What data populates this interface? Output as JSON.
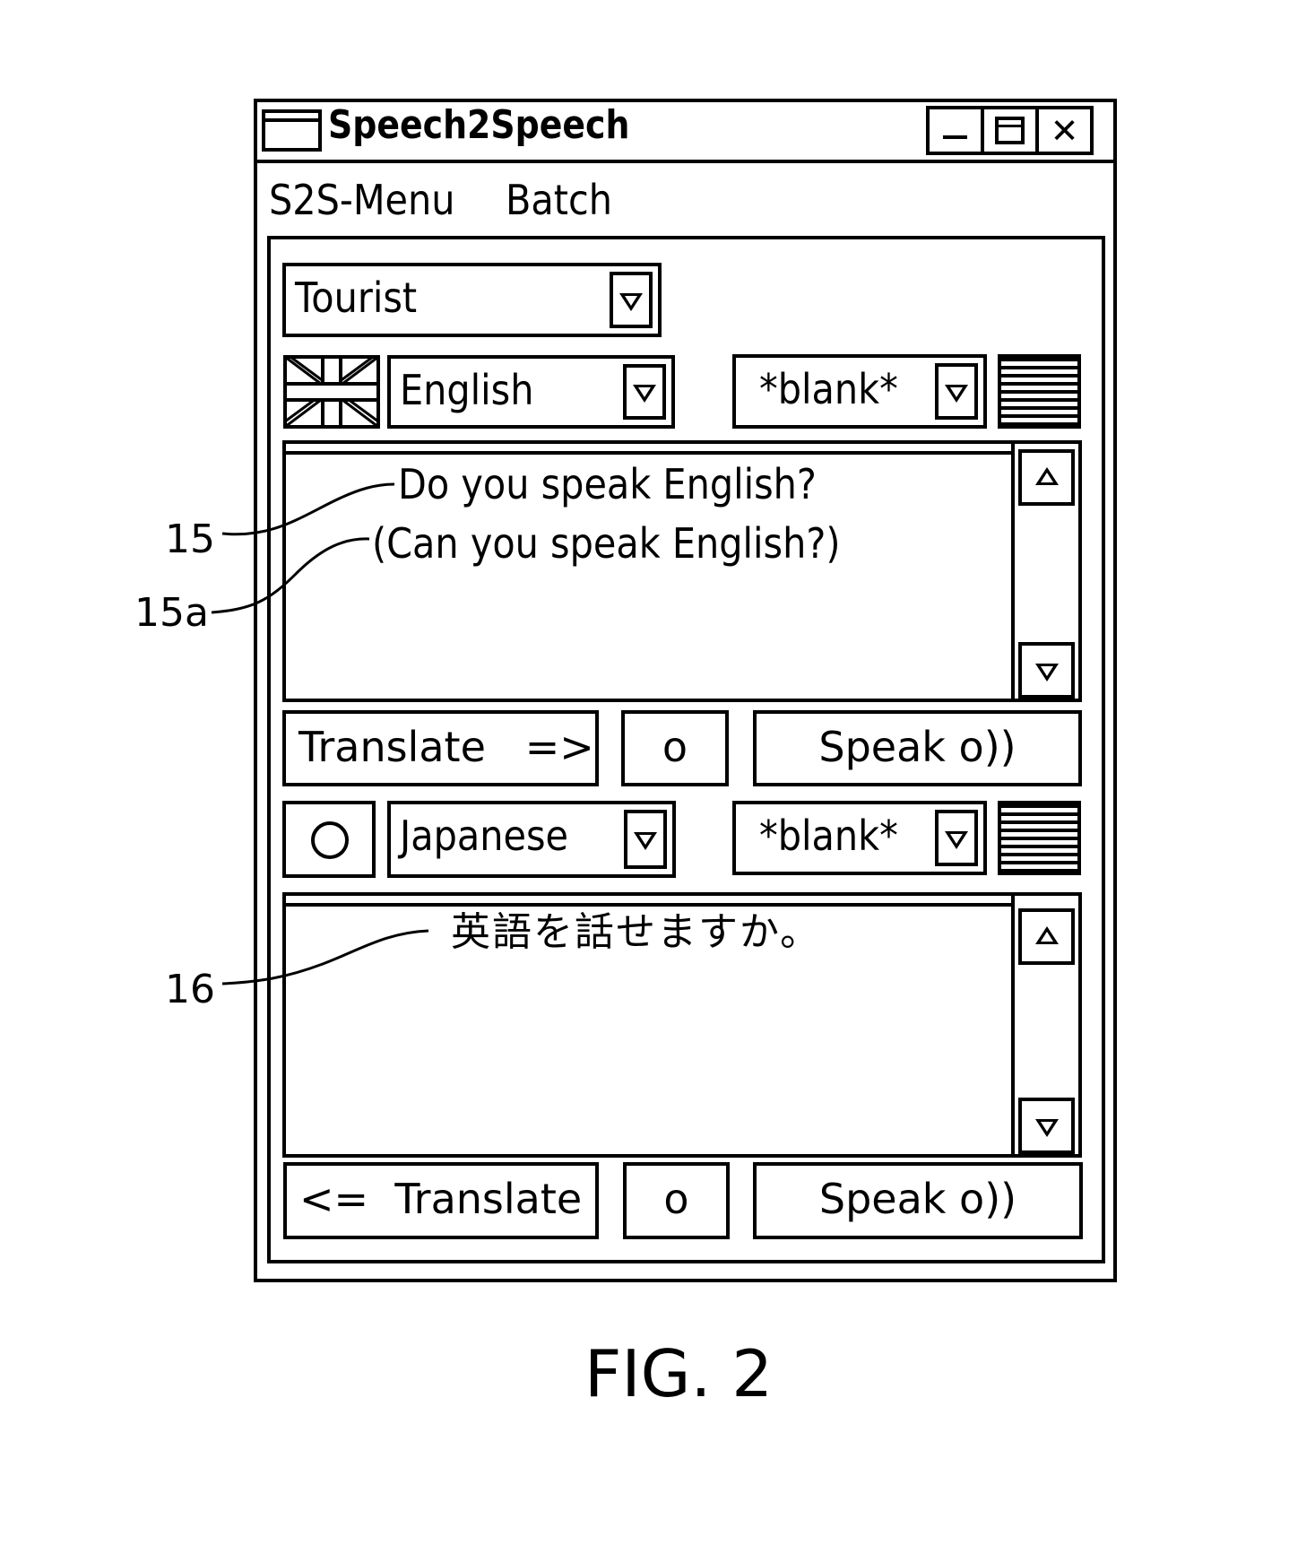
{
  "window": {
    "title": "Speech2Speech",
    "controls": {
      "minimize": "minimize",
      "maximize": "maximize",
      "close": "✕"
    }
  },
  "menu": {
    "items": [
      {
        "label": "S2S-Menu"
      },
      {
        "label": "Batch"
      }
    ]
  },
  "mode_select": {
    "value": "Tourist"
  },
  "source": {
    "flag": "uk-flag-icon",
    "language": "English",
    "voice": "*blank*",
    "text_lines": [
      "Do you speak English?",
      "(Can you speak English?)"
    ],
    "translate_label": "Translate   =>",
    "record_label": "o",
    "speak_label": "Speak o))"
  },
  "target": {
    "flag": "japan-flag-icon",
    "language": "Japanese",
    "voice": "*blank*",
    "text_lines": [
      "英語を話せますか。"
    ],
    "translate_label": "<=  Translate",
    "record_label": "o",
    "speak_label": "Speak o))"
  },
  "reference_labels": {
    "source_text": "15",
    "source_paraphrase": "15a",
    "target_text": "16"
  },
  "caption": "FIG. 2"
}
